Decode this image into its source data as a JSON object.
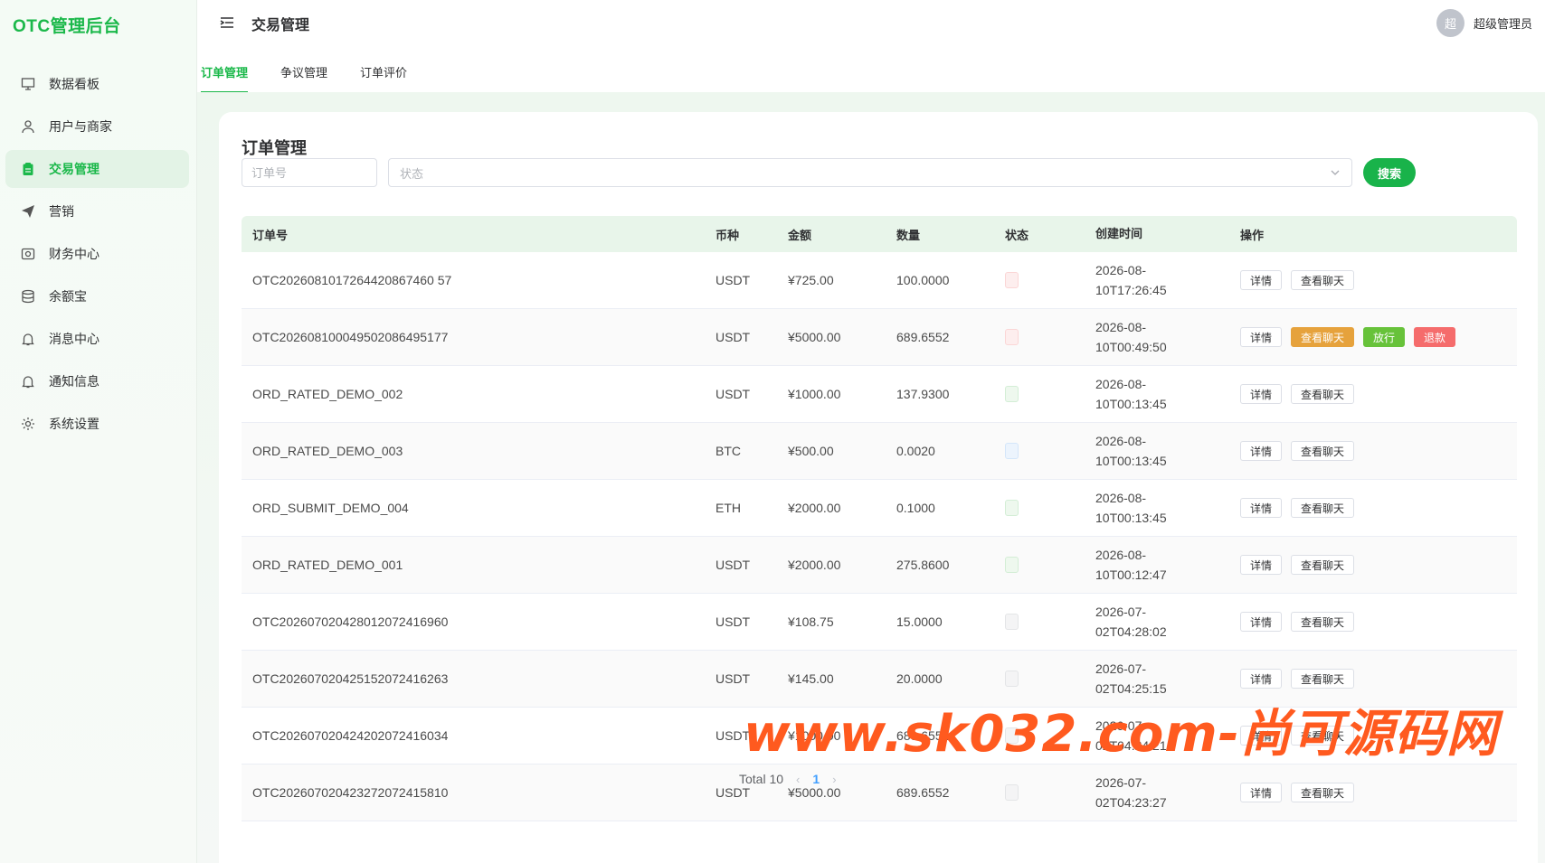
{
  "app": {
    "logo": "OTC管理后台"
  },
  "sidebar": {
    "items": [
      {
        "label": "数据看板",
        "icon": "monitor-icon"
      },
      {
        "label": "用户与商家",
        "icon": "user-icon"
      },
      {
        "label": "交易管理",
        "icon": "clipboard-icon",
        "active": true
      },
      {
        "label": "营销",
        "icon": "send-icon"
      },
      {
        "label": "财务中心",
        "icon": "finance-icon"
      },
      {
        "label": "余额宝",
        "icon": "database-icon"
      },
      {
        "label": "消息中心",
        "icon": "bell-icon"
      },
      {
        "label": "通知信息",
        "icon": "bell-icon"
      },
      {
        "label": "系统设置",
        "icon": "gear-icon"
      }
    ]
  },
  "header": {
    "title": "交易管理",
    "user": {
      "avatar": "超",
      "name": "超级管理员"
    }
  },
  "tabs": [
    {
      "label": "订单管理",
      "active": true
    },
    {
      "label": "争议管理"
    },
    {
      "label": "订单评价"
    }
  ],
  "main": {
    "title": "订单管理",
    "filters": {
      "order_placeholder": "订单号",
      "status_placeholder": "状态",
      "search_label": "搜索"
    },
    "columns": [
      "订单号",
      "币种",
      "金额",
      "数量",
      "状态",
      "创建时间",
      "操作"
    ],
    "rows": [
      {
        "order": "OTC2026081017264420867460 57",
        "coin": "USDT",
        "amount": "¥725.00",
        "qty": "100.0000",
        "status": "red",
        "date": "2026-08-",
        "time": "10T17:26:45",
        "ops": [
          "详情",
          "查看聊天"
        ]
      },
      {
        "order": "OTC202608100049502086495177",
        "coin": "USDT",
        "amount": "¥5000.00",
        "qty": "689.6552",
        "status": "red",
        "date": "2026-08-",
        "time": "10T00:49:50",
        "ops": [
          "详情",
          "查看聊天",
          "放行",
          "退款"
        ]
      },
      {
        "order": "ORD_RATED_DEMO_002",
        "coin": "USDT",
        "amount": "¥1000.00",
        "qty": "137.9300",
        "status": "green",
        "date": "2026-08-",
        "time": "10T00:13:45",
        "ops": [
          "详情",
          "查看聊天"
        ]
      },
      {
        "order": "ORD_RATED_DEMO_003",
        "coin": "BTC",
        "amount": "¥500.00",
        "qty": "0.0020",
        "status": "blue",
        "date": "2026-08-",
        "time": "10T00:13:45",
        "ops": [
          "详情",
          "查看聊天"
        ]
      },
      {
        "order": "ORD_SUBMIT_DEMO_004",
        "coin": "ETH",
        "amount": "¥2000.00",
        "qty": "0.1000",
        "status": "green",
        "date": "2026-08-",
        "time": "10T00:13:45",
        "ops": [
          "详情",
          "查看聊天"
        ]
      },
      {
        "order": "ORD_RATED_DEMO_001",
        "coin": "USDT",
        "amount": "¥2000.00",
        "qty": "275.8600",
        "status": "green",
        "date": "2026-08-",
        "time": "10T00:12:47",
        "ops": [
          "详情",
          "查看聊天"
        ]
      },
      {
        "order": "OTC202607020428012072416960",
        "coin": "USDT",
        "amount": "¥108.75",
        "qty": "15.0000",
        "status": "gray",
        "date": "2026-07-",
        "time": "02T04:28:02",
        "ops": [
          "详情",
          "查看聊天"
        ]
      },
      {
        "order": "OTC202607020425152072416263",
        "coin": "USDT",
        "amount": "¥145.00",
        "qty": "20.0000",
        "status": "gray",
        "date": "2026-07-",
        "time": "02T04:25:15",
        "ops": [
          "详情",
          "查看聊天"
        ]
      },
      {
        "order": "OTC202607020424202072416034",
        "coin": "USDT",
        "amount": "¥1000.00",
        "qty": "689.6552",
        "status": "gray",
        "date": "2026-07-",
        "time": "02T04:24:21",
        "ops": [
          "详情",
          "查看聊天"
        ]
      },
      {
        "order": "OTC202607020423272072415810",
        "coin": "USDT",
        "amount": "¥5000.00",
        "qty": "689.6552",
        "status": "gray",
        "date": "2026-07-",
        "time": "02T04:23:27",
        "ops": [
          "详情",
          "查看聊天"
        ]
      }
    ],
    "pagination": {
      "total": "Total 10",
      "page": "1"
    }
  },
  "watermark": "www.sk032.com-尚可源码网",
  "colors": {
    "brand": "#1bb84a",
    "warning": "#e6a23c",
    "success": "#67c23a",
    "danger": "#f56c6c"
  }
}
